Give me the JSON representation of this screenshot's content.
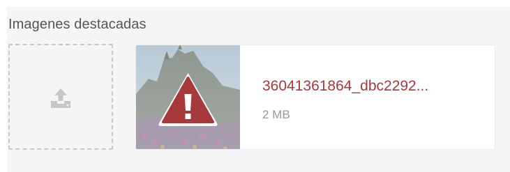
{
  "section": {
    "label": "Imagenes destacadas"
  },
  "upload": {
    "icon": "upload-icon"
  },
  "file": {
    "name": "36041361864_dbc2292...",
    "size": "2 MB",
    "status_icon": "warning-icon",
    "status_color": "#a63a3a"
  },
  "colors": {
    "panel_bg": "#f5f5f5",
    "error_red": "#a63a3a",
    "muted_text": "#999999"
  }
}
